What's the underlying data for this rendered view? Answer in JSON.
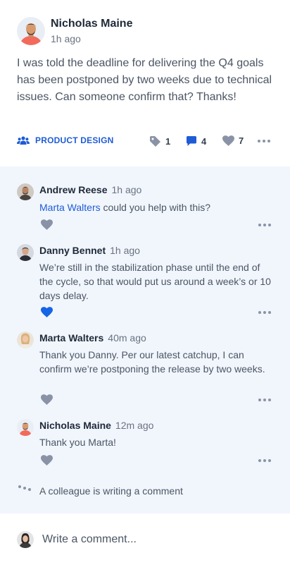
{
  "post": {
    "author": {
      "name": "Nicholas Maine",
      "time": "1h ago"
    },
    "body": "I was told the deadline for delivering the Q4 goals has been postponed by two weeks due to technical issues. Can someone confirm that? Thanks!",
    "group": {
      "label": "PRODUCT DESIGN",
      "icon": "users-icon"
    },
    "stats": {
      "tags": "1",
      "comments": "4",
      "likes": "7"
    }
  },
  "comments": [
    {
      "author": "Andrew Reese",
      "time": "1h ago",
      "mention": "Marta Walters",
      "text": " could you help with this?",
      "liked": false
    },
    {
      "author": "Danny Bennet",
      "time": "1h ago",
      "mention": "",
      "text": "We’re still in the stabilization phase until the end of the cycle, so that would put us around a week’s or 10 days delay.",
      "liked": true
    },
    {
      "author": "Marta Walters",
      "time": "40m ago",
      "mention": "",
      "text": "Thank you Danny. Per our latest catchup, I can confirm we’re postponing the release by two weeks.",
      "liked": false
    },
    {
      "author": "Nicholas Maine",
      "time": "12m ago",
      "mention": "",
      "text": "Thank you Marta!",
      "liked": false
    }
  ],
  "typing": {
    "text": "A colleague is writing a comment"
  },
  "composer": {
    "placeholder": "Write a comment..."
  },
  "colors": {
    "accent": "#1e5cd6",
    "thread_bg": "#f1f6fd",
    "icon_muted": "#8a93a6",
    "like_active": "#1565e6"
  }
}
